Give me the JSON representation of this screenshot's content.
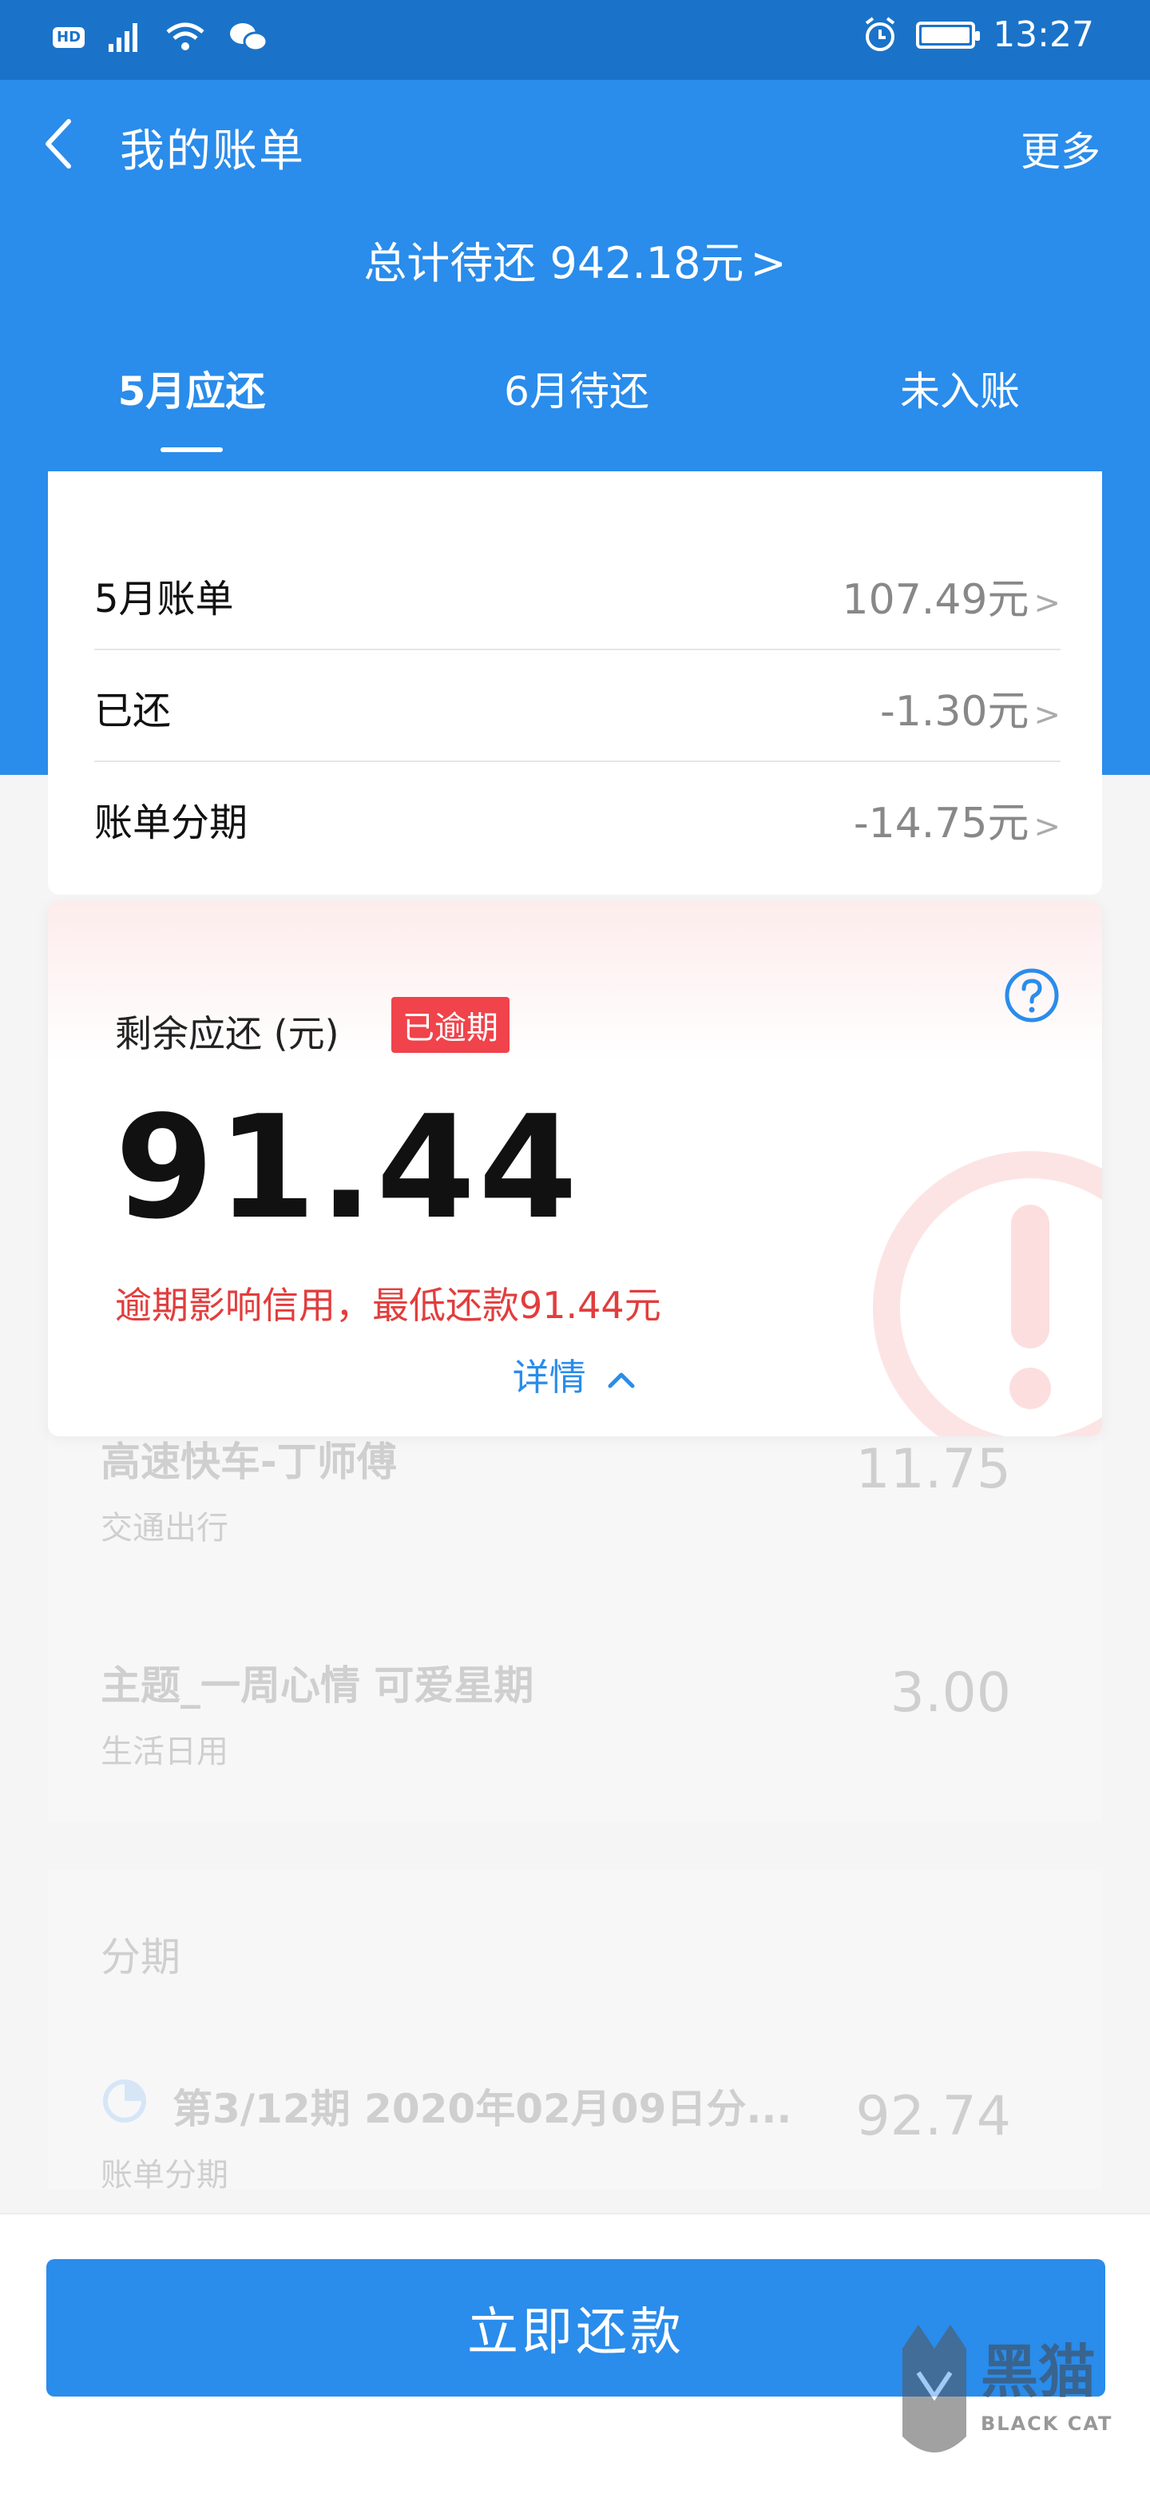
{
  "status_bar": {
    "hd_label": "HD",
    "time": "13:27",
    "battery_level": 1.0
  },
  "header": {
    "title": "我的账单",
    "more_label": "更多"
  },
  "summary": {
    "total_label": "总计待还 942.18元",
    "chevron": ">"
  },
  "tabs": [
    {
      "label": "5月应还",
      "active": true
    },
    {
      "label": "6月待还",
      "active": false
    },
    {
      "label": "未入账",
      "active": false
    }
  ],
  "bill": {
    "rows": [
      {
        "label": "5月账单",
        "value": "107.49元"
      },
      {
        "label": "已还",
        "value": "-1.30元"
      },
      {
        "label": "账单分期",
        "value": "-14.75元"
      }
    ],
    "arrow": ">"
  },
  "due": {
    "label": "剩余应还 (元)",
    "badge": "已逾期",
    "amount": "91.44",
    "warning": "逾期影响信用，最低还款91.44元",
    "detail_label": "详情"
  },
  "faded_list": {
    "items": [
      {
        "title": "高速快车-丁师傅",
        "subtitle": "交通出行",
        "amount": "11.75"
      },
      {
        "title": "主题_一周心情 可爱星期",
        "subtitle": "生活日用",
        "amount": "3.00"
      }
    ],
    "section_label": "分期",
    "installment": {
      "title": "第3/12期 2020年02月09日分...",
      "subtitle": "账单分期",
      "amount": "92.74"
    }
  },
  "bottom": {
    "pay_label": "立即还款"
  },
  "watermark": {
    "text_cn": "黑猫",
    "text_en": "BLACK CAT"
  },
  "colors": {
    "primary": "#2a8ceb",
    "status_bar": "#1a73c9",
    "alert": "#f0434b"
  }
}
